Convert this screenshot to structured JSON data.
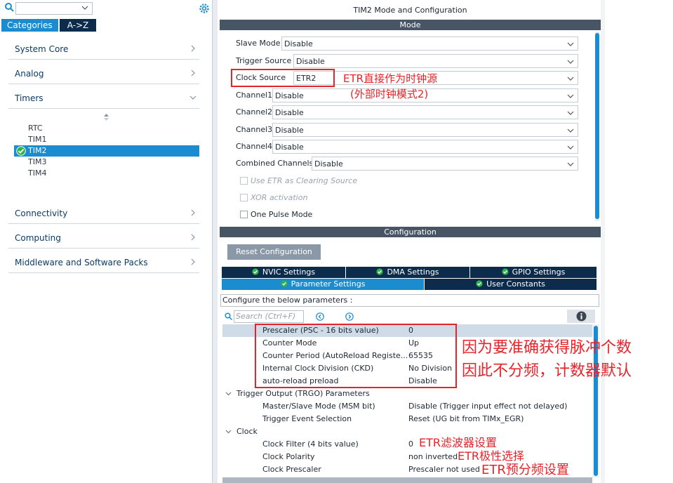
{
  "left_panel": {
    "search": {
      "value": ""
    },
    "tabs": [
      {
        "label": "Categories"
      },
      {
        "label": "A->Z"
      }
    ],
    "categories": [
      {
        "label": "System Core"
      },
      {
        "label": "Analog"
      },
      {
        "label": "Timers"
      },
      {
        "label": "Connectivity"
      },
      {
        "label": "Computing"
      },
      {
        "label": "Middleware and Software Packs"
      }
    ],
    "timers": [
      {
        "label": "RTC"
      },
      {
        "label": "TIM1"
      },
      {
        "label": "TIM2"
      },
      {
        "label": "TIM3"
      },
      {
        "label": "TIM4"
      }
    ]
  },
  "right_panel": {
    "title": "TIM2 Mode and Configuration",
    "mode_header": "Mode",
    "mode_fields": [
      {
        "label": "Slave Mode",
        "value": "Disable"
      },
      {
        "label": "Trigger Source",
        "value": "Disable"
      },
      {
        "label": "Clock Source",
        "value": "ETR2"
      },
      {
        "label": "Channel1",
        "value": "Disable"
      },
      {
        "label": "Channel2",
        "value": "Disable"
      },
      {
        "label": "Channel3",
        "value": "Disable"
      },
      {
        "label": "Channel4",
        "value": "Disable"
      },
      {
        "label": "Combined Channels",
        "value": "Disable"
      }
    ],
    "checkboxes": [
      {
        "label": "Use ETR as Clearing Source",
        "enabled": false
      },
      {
        "label": "XOR activation",
        "enabled": false
      },
      {
        "label": "One Pulse Mode",
        "enabled": true
      }
    ],
    "config_header": "Configuration",
    "reset_button": "Reset Configuration",
    "settings_tabs_row1": [
      {
        "label": "NVIC Settings"
      },
      {
        "label": "DMA Settings"
      },
      {
        "label": "GPIO Settings"
      }
    ],
    "settings_tabs_row2": [
      {
        "label": "Parameter Settings"
      },
      {
        "label": "User Constants"
      }
    ],
    "configure_text": "Configure the below parameters :",
    "param_search_placeholder": "Search (Ctrl+F)",
    "parameters": [
      {
        "name": "Prescaler (PSC - 16 bits value)",
        "value": "0"
      },
      {
        "name": "Counter Mode",
        "value": "Up"
      },
      {
        "name": "Counter Period (AutoReload Registe...",
        "value": "65535"
      },
      {
        "name": "Internal Clock Division (CKD)",
        "value": "No Division"
      },
      {
        "name": "auto-reload preload",
        "value": "Disable"
      },
      {
        "name": "Trigger Output (TRGO) Parameters",
        "value": ""
      },
      {
        "name": "Master/Slave Mode (MSM bit)",
        "value": "Disable (Trigger input effect not delayed)"
      },
      {
        "name": "Trigger Event Selection",
        "value": "Reset (UG bit from TIMx_EGR)"
      },
      {
        "name": "Clock",
        "value": ""
      },
      {
        "name": "Clock Filter (4 bits value)",
        "value": "0"
      },
      {
        "name": "Clock Polarity",
        "value": "non inverted"
      },
      {
        "name": "Clock Prescaler",
        "value": "Prescaler not used"
      }
    ]
  },
  "annotations": {
    "etr_direct": "ETR直接作为时钟源",
    "etr_mode2": "(外部时钟模式2)",
    "count_line1": "因为要准确获得脉冲个数",
    "count_line2": "因此不分频，计数器默认",
    "etr_filter": "ETR滤波器设置",
    "etr_polarity": "ETR极性选择",
    "etr_prescaler": "ETR预分频设置"
  },
  "colors": {
    "accent": "#1a8ccf",
    "header_dark": "#475564",
    "tab_dark": "#0d2b4a",
    "annotation_red": "#e8232a"
  }
}
